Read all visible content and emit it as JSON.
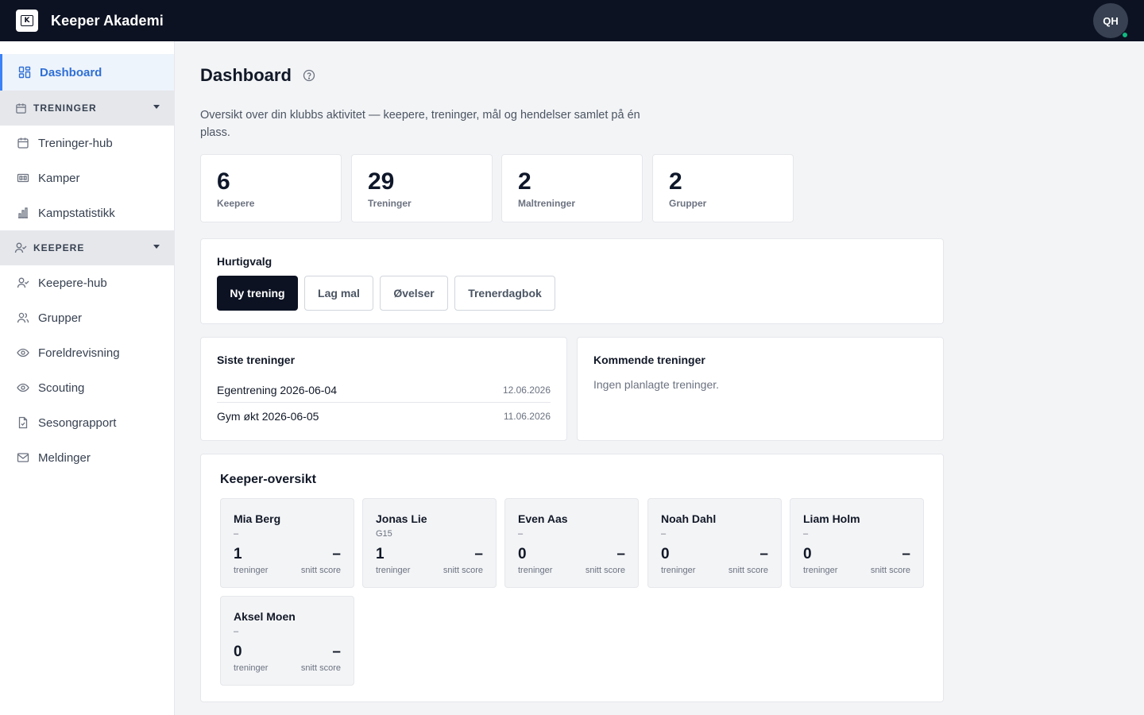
{
  "app": {
    "title": "Keeper Akademi",
    "logo_letter": "K",
    "user_initials": "QH"
  },
  "sidebar": {
    "dashboard": "Dashboard",
    "sections": [
      {
        "label": "TRENINGER",
        "items": [
          "Treninger-hub",
          "Kamper",
          "Kampstatistikk"
        ]
      },
      {
        "label": "KEEPERE",
        "items": [
          "Keepere-hub",
          "Grupper",
          "Foreldrevisning",
          "Scouting",
          "Sesongrapport",
          "Meldinger"
        ]
      }
    ]
  },
  "page": {
    "title": "Dashboard",
    "description": "Oversikt over din klubbs aktivitet — keepere, treninger, mål og hendelser samlet på én plass."
  },
  "stats": [
    {
      "value": "6",
      "label": "Keepere"
    },
    {
      "value": "29",
      "label": "Treninger"
    },
    {
      "value": "2",
      "label": "Maltreninger"
    },
    {
      "value": "2",
      "label": "Grupper"
    }
  ],
  "quick": {
    "title": "Hurtigvalg",
    "buttons": [
      "Ny trening",
      "Lag mal",
      "Øvelser",
      "Trenerdagbok"
    ]
  },
  "recent": {
    "title": "Siste treninger",
    "items": [
      {
        "name": "Egentrening 2026-06-04",
        "date": "12.06.2026"
      },
      {
        "name": "Gym økt 2026-06-05",
        "date": "11.06.2026"
      }
    ]
  },
  "upcoming": {
    "title": "Kommende treninger",
    "empty": "Ingen planlagte treninger."
  },
  "keepers": {
    "title": "Keeper-oversikt",
    "count_label": "treninger",
    "score_label": "snitt score",
    "items": [
      {
        "name": "Mia Berg",
        "group": "–",
        "sessions": "1",
        "score": "–"
      },
      {
        "name": "Jonas Lie",
        "group": "G15",
        "sessions": "1",
        "score": "–"
      },
      {
        "name": "Even Aas",
        "group": "–",
        "sessions": "0",
        "score": "–"
      },
      {
        "name": "Noah Dahl",
        "group": "–",
        "sessions": "0",
        "score": "–"
      },
      {
        "name": "Liam Holm",
        "group": "–",
        "sessions": "0",
        "score": "–"
      },
      {
        "name": "Aksel Moen",
        "group": "–",
        "sessions": "0",
        "score": "–"
      }
    ]
  },
  "colors": {
    "topbar": "#0c1222",
    "accent": "#2f6fd6",
    "status_online": "#10b981"
  }
}
